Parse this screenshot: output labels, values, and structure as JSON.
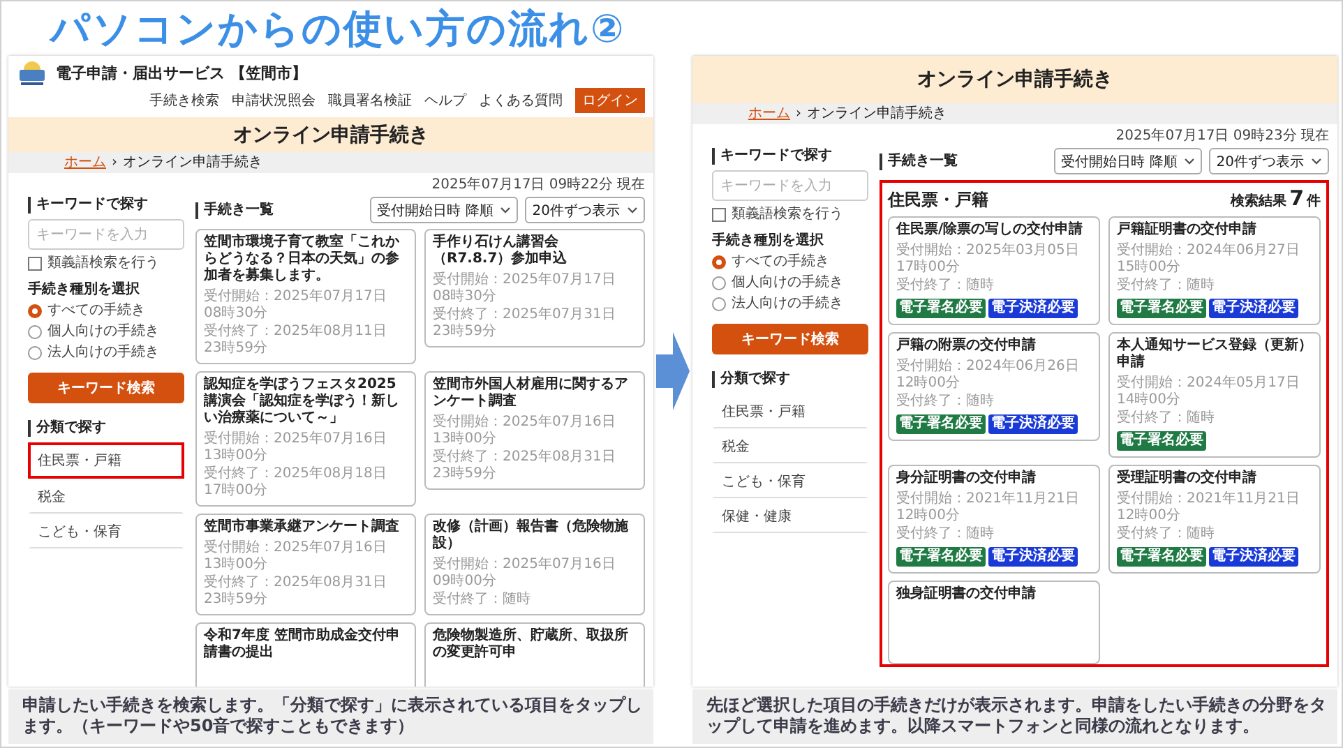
{
  "slide": {
    "title": "パソコンからの使い方の流れ②"
  },
  "screens": [
    {
      "header": {
        "site_title": "電子申請・届出サービス 【笠間市】",
        "nav": [
          "手続き検索",
          "申請状況照会",
          "職員署名検証",
          "ヘルプ",
          "よくある質問"
        ],
        "login": "ログイン"
      },
      "banner_title": "オンライン申請手続き",
      "breadcrumb": {
        "home": "ホーム",
        "separator": "›",
        "current": "オンライン申請手続き"
      },
      "timestamp": "2025年07月17日 09時22分 現在",
      "search": {
        "heading": "キーワードで探す",
        "placeholder": "キーワードを入力",
        "option_label": "類義語検索を行う",
        "option_checked": false,
        "type_heading": "手続き種別を選択",
        "types": [
          {
            "label": "すべての手続き",
            "selected": true
          },
          {
            "label": "個人向けの手続き",
            "selected": false
          },
          {
            "label": "法人向けの手続き",
            "selected": false
          }
        ],
        "button": "キーワード検索"
      },
      "category": {
        "heading": "分類で探す",
        "items": [
          {
            "label": "住民票・戸籍",
            "highlighted": true
          },
          {
            "label": "税金",
            "highlighted": false
          },
          {
            "label": "こども・保育",
            "highlighted": false
          }
        ]
      },
      "list": {
        "heading": "手続き一覧",
        "sort": "受付開始日時 降順",
        "per_page": "20件ずつ表示",
        "cards": [
          {
            "title": "笠間市環境子育て教室「これからどうなる？日本の天気」の参加者を募集します。",
            "start": "受付開始：2025年07月17日 08時30分",
            "end": "受付終了：2025年08月11日 23時59分"
          },
          {
            "title": "手作り石けん講習会（R7.8.7）参加申込",
            "start": "受付開始：2025年07月17日 08時30分",
            "end": "受付終了：2025年07月31日 23時59分"
          },
          {
            "title": "認知症を学ぼうフェスタ2025 講演会「認知症を学ぼう！新しい治療薬について～」",
            "start": "受付開始：2025年07月16日 13時00分",
            "end": "受付終了：2025年08月18日 17時00分"
          },
          {
            "title": "笠間市外国人材雇用に関するアンケート調査",
            "start": "受付開始：2025年07月16日 13時00分",
            "end": "受付終了：2025年08月31日 23時59分"
          },
          {
            "title": "笠間市事業承継アンケート調査",
            "start": "受付開始：2025年07月16日 13時00分",
            "end": "受付終了：2025年08月31日 23時59分"
          },
          {
            "title": "改修（計画）報告書（危険物施設）",
            "start": "受付開始：2025年07月16日 09時00分",
            "end": "受付終了：随時"
          },
          {
            "title": "令和7年度 笠間市助成金交付申請書の提出"
          },
          {
            "title": "危険物製造所、貯蔵所、取扱所の変更許可申"
          }
        ]
      }
    },
    {
      "banner_title": "オンライン申請手続き",
      "breadcrumb": {
        "home": "ホーム",
        "separator": "›",
        "current": "オンライン申請手続き"
      },
      "timestamp": "2025年07月17日 09時23分 現在",
      "search": {
        "heading": "キーワードで探す",
        "placeholder": "キーワードを入力",
        "option_label": "類義語検索を行う",
        "option_checked": false,
        "type_heading": "手続き種別を選択",
        "types": [
          {
            "label": "すべての手続き",
            "selected": true
          },
          {
            "label": "個人向けの手続き",
            "selected": false
          },
          {
            "label": "法人向けの手続き",
            "selected": false
          }
        ],
        "button": "キーワード検索"
      },
      "category": {
        "heading": "分類で探す",
        "items": [
          {
            "label": "住民票・戸籍",
            "highlighted": false
          },
          {
            "label": "税金",
            "highlighted": false
          },
          {
            "label": "こども・保育",
            "highlighted": false
          },
          {
            "label": "保健・健康",
            "highlighted": false
          }
        ]
      },
      "list": {
        "heading": "手続き一覧",
        "sort": "受付開始日時 降順",
        "per_page": "20件ずつ表示",
        "results": {
          "highlighted": true,
          "category_title": "住民票・戸籍",
          "count_label": "検索結果",
          "count": "7",
          "unit": "件"
        },
        "cards": [
          {
            "title": "住民票/除票の写しの交付申請",
            "start": "受付開始：2025年03月05日 17時00分",
            "end": "受付終了：随時",
            "tags": [
              {
                "label": "電子署名必要",
                "kind": "signature"
              },
              {
                "label": "電子決済必要",
                "kind": "payment"
              }
            ]
          },
          {
            "title": "戸籍証明書の交付申請",
            "start": "受付開始：2024年06月27日 15時00分",
            "end": "受付終了：随時",
            "tags": [
              {
                "label": "電子署名必要",
                "kind": "signature"
              },
              {
                "label": "電子決済必要",
                "kind": "payment"
              }
            ]
          },
          {
            "title": "戸籍の附票の交付申請",
            "start": "受付開始：2024年06月26日 12時00分",
            "end": "受付終了：随時",
            "tags": [
              {
                "label": "電子署名必要",
                "kind": "signature"
              },
              {
                "label": "電子決済必要",
                "kind": "payment"
              }
            ]
          },
          {
            "title": "本人通知サービス登録（更新）申請",
            "start": "受付開始：2024年05月17日 14時00分",
            "end": "受付終了：随時",
            "tags": [
              {
                "label": "電子署名必要",
                "kind": "signature"
              }
            ]
          },
          {
            "title": "身分証明書の交付申請",
            "start": "受付開始：2021年11月21日 12時00分",
            "end": "受付終了：随時",
            "tags": [
              {
                "label": "電子署名必要",
                "kind": "signature"
              },
              {
                "label": "電子決済必要",
                "kind": "payment"
              }
            ]
          },
          {
            "title": "受理証明書の交付申請",
            "start": "受付開始：2021年11月21日 12時00分",
            "end": "受付終了：随時",
            "tags": [
              {
                "label": "電子署名必要",
                "kind": "signature"
              },
              {
                "label": "電子決済必要",
                "kind": "payment"
              }
            ]
          },
          {
            "title": "独身証明書の交付申請"
          }
        ]
      }
    }
  ],
  "captions": [
    "申請したい手続きを検索します。「分類で探す」に表示されている項目をタップします。（キーワードや50音で探すこともできます）",
    "先ほど選択した項目の手続きだけが表示されます。申請をしたい手続きの分野をタップして申請を進めます。以降スマートフォンと同様の流れとなります。"
  ]
}
